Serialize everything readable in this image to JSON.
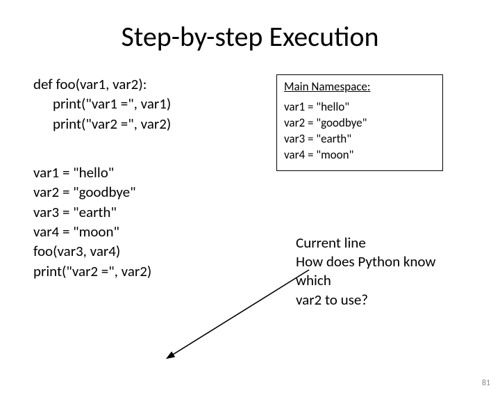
{
  "title": "Step-by-step Execution",
  "code": {
    "l1": "def foo(var1, var2):",
    "l2": "print(\"var1 =\", var1)",
    "l3": "print(\"var2 =\", var2)",
    "b1": "var1 = \"hello\"",
    "b2": "var2 = \"goodbye\"",
    "b3": "var3 = \"earth\"",
    "b4": "var4 = \"moon\"",
    "b5": "foo(var3, var4)",
    "b6": "print(\"var2 =\", var2)"
  },
  "namespace": {
    "title": "Main Namespace:",
    "n1": "var1 = \"hello\"",
    "n2": "var2 = \"goodbye\"",
    "n3": "var3 = \"earth\"",
    "n4": "var4 = \"moon\""
  },
  "question": {
    "q1": "Current line",
    "q2": "How does Python know which",
    "q3": "var2 to use?"
  },
  "pagenum": "81"
}
